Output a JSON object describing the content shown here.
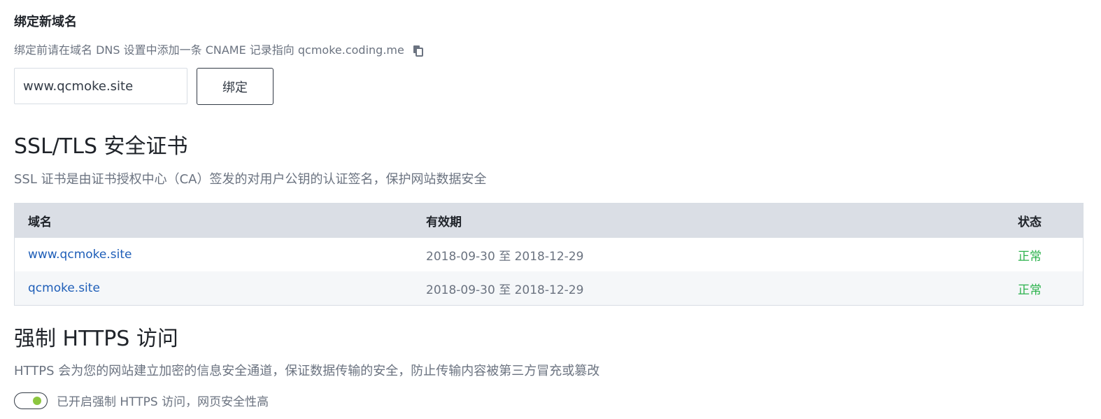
{
  "bind_domain": {
    "title": "绑定新域名",
    "hint": "绑定前请在域名 DNS 设置中添加一条 CNAME 记录指向 qcmoke.coding.me",
    "input_value": "www.qcmoke.site",
    "button_label": "绑定",
    "copy_icon": "copy-icon"
  },
  "ssl": {
    "title": "SSL/TLS 安全证书",
    "description": "SSL 证书是由证书授权中心（CA）签发的对用户公钥的认证签名，保护网站数据安全",
    "table": {
      "headers": {
        "domain": "域名",
        "validity": "有效期",
        "status": "状态"
      },
      "rows": [
        {
          "domain": "www.qcmoke.site",
          "validity": "2018-09-30 至 2018-12-29",
          "status": "正常"
        },
        {
          "domain": "qcmoke.site",
          "validity": "2018-09-30 至 2018-12-29",
          "status": "正常"
        }
      ]
    }
  },
  "https": {
    "title": "强制 HTTPS 访问",
    "description": "HTTPS 会为您的网站建立加密的信息安全通道，保证数据传输的安全，防止传输内容被第三方冒充或篡改",
    "toggle_on": true,
    "toggle_label": "已开启强制 HTTPS 访问，网页安全性高"
  },
  "colors": {
    "link": "#1e5eb8",
    "status_ok": "#2bb24c",
    "toggle_knob": "#8cc63f",
    "table_header_bg": "#dadee5"
  }
}
